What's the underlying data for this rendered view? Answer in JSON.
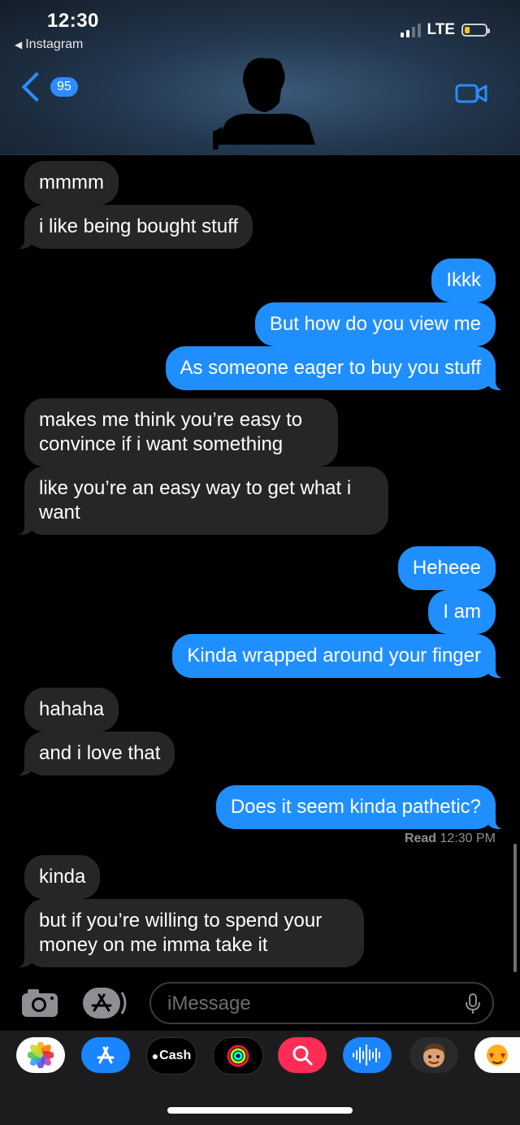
{
  "status": {
    "time": "12:30",
    "back_app": "Instagram",
    "network": "LTE"
  },
  "nav": {
    "badge_count": "95"
  },
  "messages": [
    {
      "side": "recv",
      "text": "mmmm"
    },
    {
      "side": "recv",
      "text": "i like being bought stuff"
    },
    {
      "side": "sent",
      "text": "Ikkk"
    },
    {
      "side": "sent",
      "text": "But how do you view me"
    },
    {
      "side": "sent",
      "text": "As someone eager to buy you stuff"
    },
    {
      "side": "recv",
      "text": "makes me think you’re easy to convince if i want something"
    },
    {
      "side": "recv",
      "text": "like you’re an easy way to get what i want"
    },
    {
      "side": "sent",
      "text": "Heheee"
    },
    {
      "side": "sent",
      "text": "I am"
    },
    {
      "side": "sent",
      "text": "Kinda wrapped around your finger"
    },
    {
      "side": "recv",
      "text": "hahaha"
    },
    {
      "side": "recv",
      "text": "and i love that"
    },
    {
      "side": "sent",
      "text": "Does it seem kinda pathetic?"
    },
    {
      "side": "recv",
      "text": "kinda"
    },
    {
      "side": "recv",
      "text": "but if you’re willing to spend your money on me imma take it"
    }
  ],
  "receipt": {
    "label": "Read",
    "time": "12:30 PM"
  },
  "input": {
    "placeholder": "iMessage"
  },
  "drawer": {
    "cash_label": "Cash"
  },
  "colors": {
    "sent": "#1f8fff",
    "received": "#262628",
    "accent": "#2b8cff"
  }
}
